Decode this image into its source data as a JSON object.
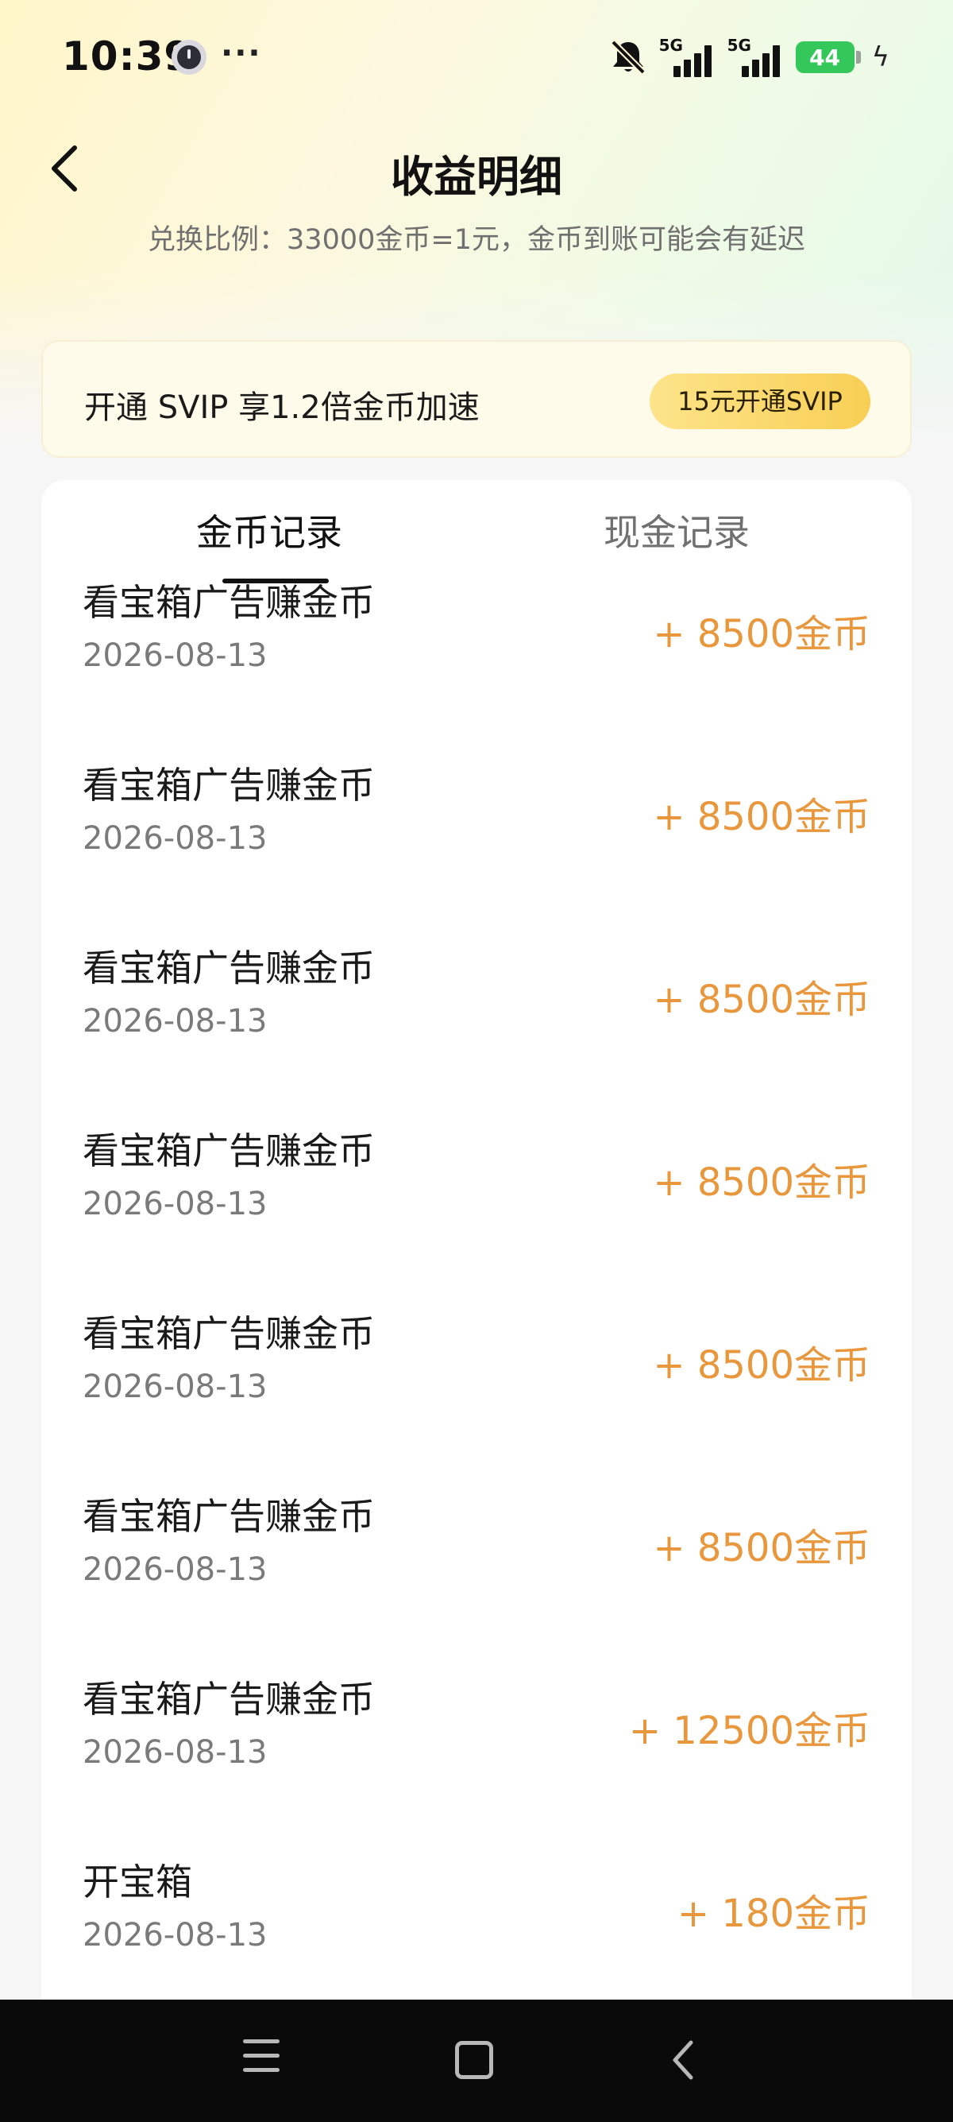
{
  "status_bar": {
    "time": "10:39",
    "more": "···",
    "signal_1": "5G",
    "signal_2": "5G",
    "battery": "44",
    "charging": "ϟ"
  },
  "header": {
    "title": "收益明细",
    "exchange_note": "兑换比例：33000金币=1元，金币到账可能会有延迟"
  },
  "svip_banner": {
    "text": "开通 SVIP 享1.2倍金币加速",
    "button_label": "15元开通SVIP"
  },
  "tabs": [
    {
      "label": "金币记录",
      "active": true
    },
    {
      "label": "现金记录",
      "active": false
    }
  ],
  "records": [
    {
      "title": "看宝箱广告赚金币",
      "date": "2026-08-13",
      "amount": "+ 8500金币"
    },
    {
      "title": "看宝箱广告赚金币",
      "date": "2026-08-13",
      "amount": "+ 8500金币"
    },
    {
      "title": "看宝箱广告赚金币",
      "date": "2026-08-13",
      "amount": "+ 8500金币"
    },
    {
      "title": "看宝箱广告赚金币",
      "date": "2026-08-13",
      "amount": "+ 8500金币"
    },
    {
      "title": "看宝箱广告赚金币",
      "date": "2026-08-13",
      "amount": "+ 8500金币"
    },
    {
      "title": "看宝箱广告赚金币",
      "date": "2026-08-13",
      "amount": "+ 8500金币"
    },
    {
      "title": "看宝箱广告赚金币",
      "date": "2026-08-13",
      "amount": "+ 12500金币"
    },
    {
      "title": "开宝箱",
      "date": "2026-08-13",
      "amount": "+ 180金币"
    }
  ],
  "colors": {
    "amount": "#e8973c",
    "accent_gold": "#f8cf55",
    "battery_green": "#34c759"
  },
  "icons": {
    "back": "chevron-left-icon",
    "bell_off": "bell-off-icon",
    "nav_menu": "menu-icon",
    "nav_home": "home-square-icon",
    "nav_back": "back-icon"
  }
}
